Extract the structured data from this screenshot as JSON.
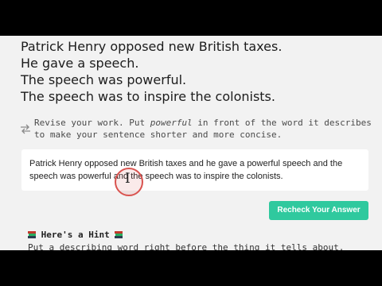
{
  "sentences": [
    "Patrick Henry opposed new British taxes.",
    "He gave a speech.",
    "The speech was powerful.",
    "The speech was to inspire the colonists."
  ],
  "instruction": {
    "icon": "swap-arrows-icon",
    "before": "Revise your work. Put ",
    "emphasis": "powerful",
    "after": " in front of the word it describes to make your sentence shorter and more concise."
  },
  "answer": {
    "line1": "Patrick Henry opposed new British taxes and he gave a powerful speech and the",
    "line2": "speech was powerful and the speech was to inspire the colonists."
  },
  "recheck_button": {
    "label": "Recheck Your Answer",
    "color": "#2fc99e"
  },
  "hint": {
    "icon": "book-stack-icon",
    "title": "Here's a Hint",
    "body": "Put a describing word right before the thing it tells about."
  }
}
